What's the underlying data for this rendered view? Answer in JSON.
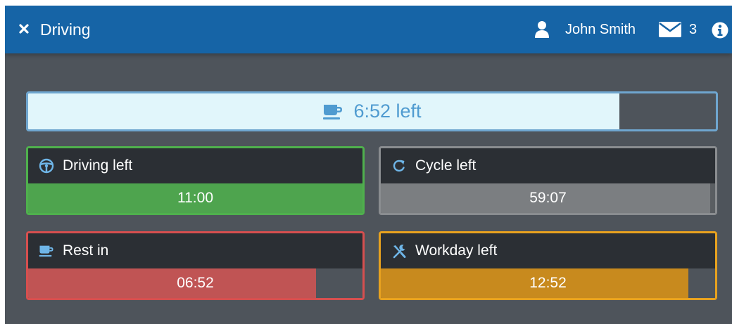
{
  "header": {
    "title": "Driving",
    "close_icon": "close-icon",
    "user_icon": "user-icon",
    "user_name": "John Smith",
    "mail_icon": "envelope-icon",
    "mail_count": "3",
    "info_icon": "info-icon",
    "background_color": "#1664a6"
  },
  "break_timer": {
    "icon": "coffee-cup-icon",
    "label": "6:52 left",
    "fill_fraction": 0.86,
    "fill_color": "#e1f6fb",
    "text_color": "#4f9bd0",
    "border_color": "#6fa6cf"
  },
  "cards": [
    {
      "id": "driving",
      "icon": "steering-wheel-icon",
      "label": "Driving left",
      "value": "11:00",
      "fill_fraction": 1.0,
      "color": "#4ea44e",
      "border_color": "#4fb04d"
    },
    {
      "id": "cycle",
      "icon": "cycle-refresh-icon",
      "label": "Cycle left",
      "value": "59:07",
      "fill_fraction": 0.985,
      "color": "#7b7e81",
      "border_color": "#8a8d90"
    },
    {
      "id": "rest",
      "icon": "coffee-cup-icon",
      "label": "Rest in",
      "value": "06:52",
      "fill_fraction": 0.86,
      "color": "#c05454",
      "border_color": "#d64f4f"
    },
    {
      "id": "workday",
      "icon": "tools-icon",
      "label": "Workday left",
      "value": "12:52",
      "fill_fraction": 0.92,
      "color": "#c88a1e",
      "border_color": "#e8a21f"
    }
  ]
}
